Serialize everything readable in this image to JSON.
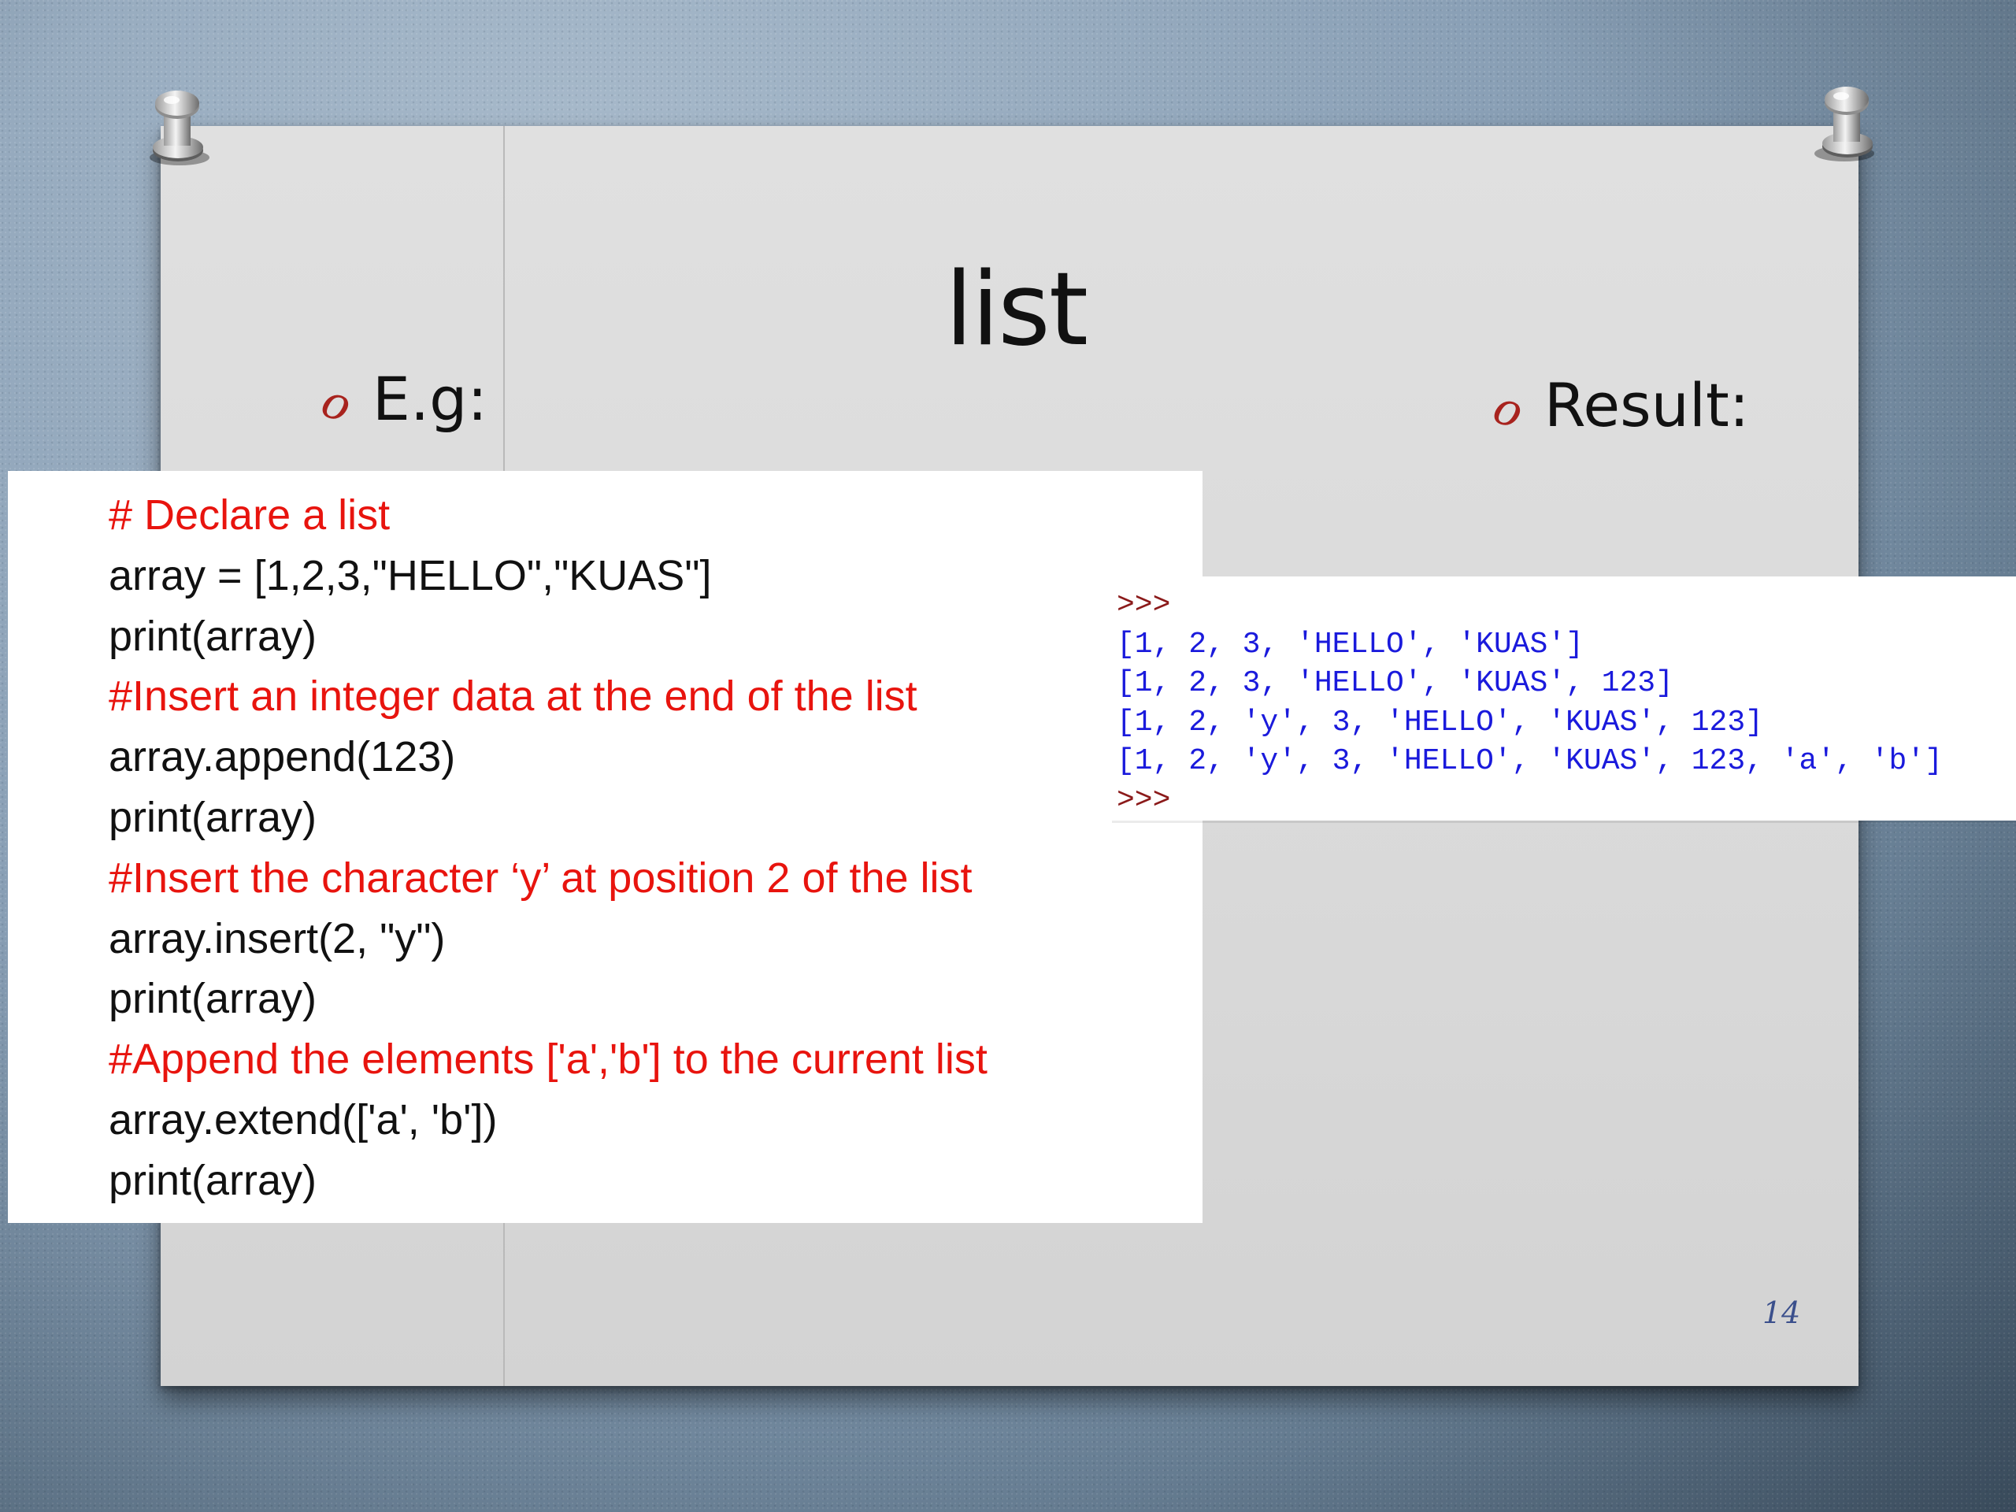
{
  "slide": {
    "title": "list",
    "left_bullet": "E.g:",
    "right_bullet": "Result:",
    "bullet_marker": "o",
    "page_number": "14"
  },
  "code": {
    "lines": [
      {
        "text": "# Declare a list",
        "kind": "comment"
      },
      {
        "text": "array = [1,2,3,\"HELLO\",\"KUAS\"]",
        "kind": "code"
      },
      {
        "text": "print(array)",
        "kind": "code"
      },
      {
        "text": "#Insert an integer data at the end of the list",
        "kind": "comment"
      },
      {
        "text": "array.append(123)",
        "kind": "code"
      },
      {
        "text": "print(array)",
        "kind": "code"
      },
      {
        "text": "#Insert the character ‘y’ at position 2 of the list",
        "kind": "comment"
      },
      {
        "text": "array.insert(2, \"y\")",
        "kind": "code"
      },
      {
        "text": "print(array)",
        "kind": "code"
      },
      {
        "text": "#Append the elements ['a','b'] to the current list",
        "kind": "comment"
      },
      {
        "text": "array.extend(['a', 'b'])",
        "kind": "code"
      },
      {
        "text": "print(array)",
        "kind": "code"
      }
    ]
  },
  "shell": {
    "lines": [
      {
        "text": ">>>",
        "kind": "prompt"
      },
      {
        "text": "[1, 2, 3, 'HELLO', 'KUAS']",
        "kind": "output"
      },
      {
        "text": "[1, 2, 3, 'HELLO', 'KUAS', 123]",
        "kind": "output"
      },
      {
        "text": "[1, 2, 'y', 3, 'HELLO', 'KUAS', 123]",
        "kind": "output"
      },
      {
        "text": "[1, 2, 'y', 3, 'HELLO', 'KUAS', 123, 'a', 'b']",
        "kind": "output"
      },
      {
        "text": ">>>",
        "kind": "prompt"
      }
    ]
  },
  "colors": {
    "comment": "#e8140e",
    "code": "#111111",
    "shell_output": "#1a1adc",
    "shell_prompt": "#8b1a1a",
    "bullet_marker": "#a8231e"
  },
  "icons": [
    "pushpin-icon",
    "pushpin-icon"
  ]
}
